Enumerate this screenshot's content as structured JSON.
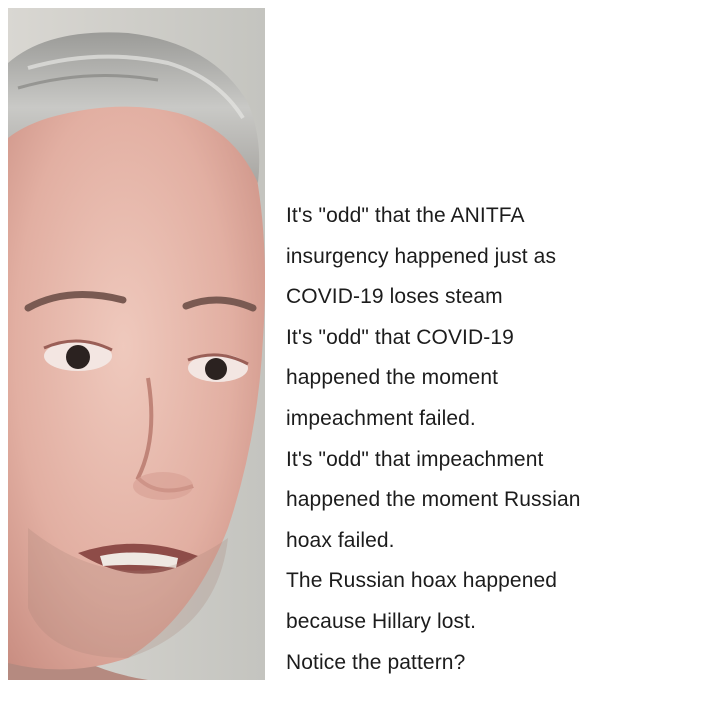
{
  "meme": {
    "lines": [
      "It's \"odd\" that the ANITFA",
      "insurgency happened just as",
      "COVID-19 loses steam",
      "It's \"odd\" that COVID-19",
      "happened the moment",
      "impeachment failed.",
      "It's \"odd\" that impeachment",
      "happened the moment Russian",
      "hoax failed.",
      "The Russian hoax happened",
      "because Hillary lost.",
      "Notice the pattern?"
    ]
  }
}
